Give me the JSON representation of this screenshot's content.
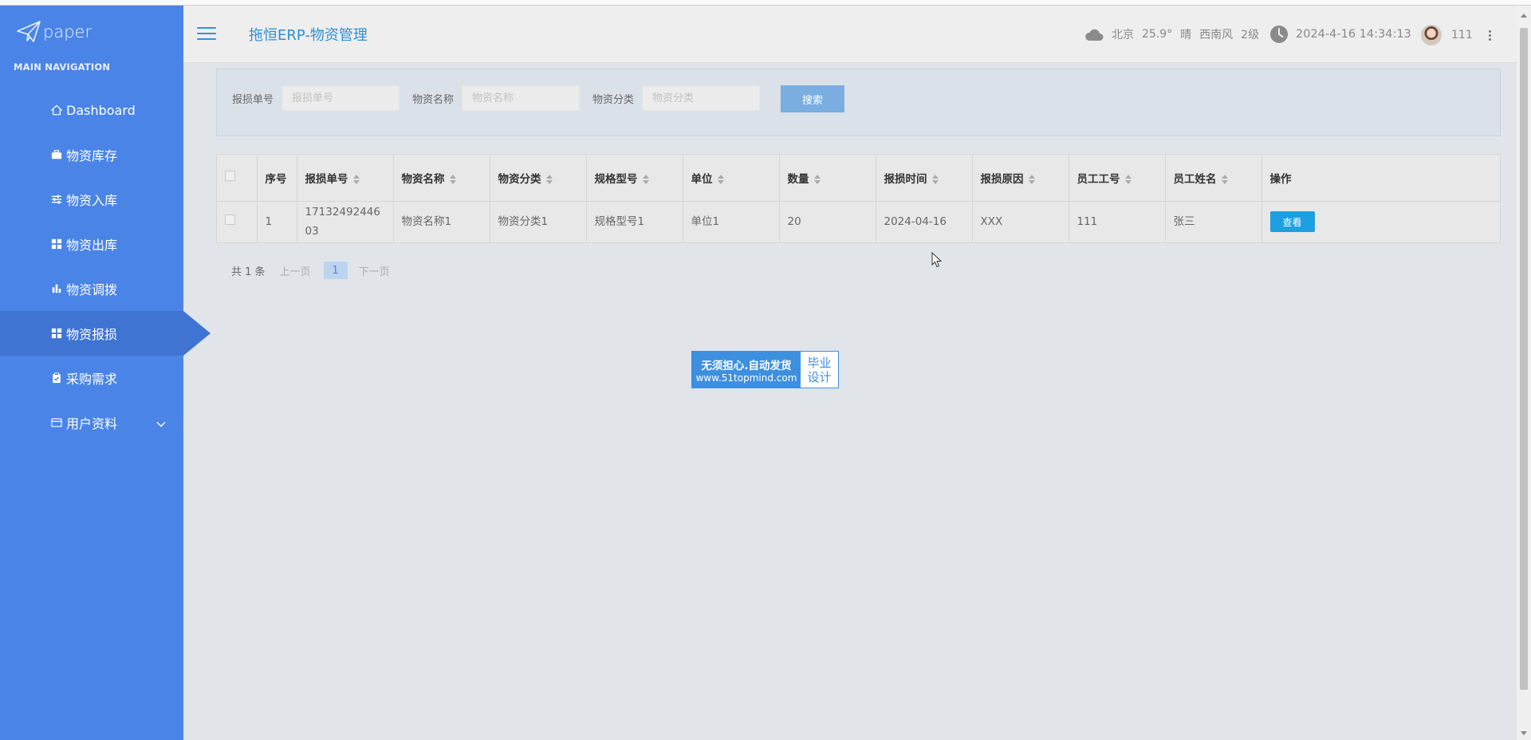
{
  "sidebar": {
    "logo_text": "paper",
    "heading": "MAIN NAVIGATION",
    "items": [
      {
        "label": "Dashboard",
        "icon": "home-icon"
      },
      {
        "label": "物资库存",
        "icon": "briefcase-icon"
      },
      {
        "label": "物资入库",
        "icon": "sliders-icon"
      },
      {
        "label": "物资出库",
        "icon": "grid-icon"
      },
      {
        "label": "物资调拨",
        "icon": "bar-chart-icon"
      },
      {
        "label": "物资报损",
        "icon": "grid-icon"
      },
      {
        "label": "采购需求",
        "icon": "clipboard-icon"
      },
      {
        "label": "用户资料",
        "icon": "card-icon"
      }
    ],
    "active_index": 5
  },
  "header": {
    "title": "拖恒ERP-物资管理",
    "weather": {
      "city": "北京",
      "temp": "25.9°",
      "condition": "晴",
      "wind": "西南风",
      "level": "2级"
    },
    "datetime": "2024-4-16 14:34:13",
    "username": "111"
  },
  "search": {
    "fields": [
      {
        "label": "报损单号",
        "placeholder": "报损单号"
      },
      {
        "label": "物资名称",
        "placeholder": "物资名称"
      },
      {
        "label": "物资分类",
        "placeholder": "物资分类"
      }
    ],
    "button": "搜索"
  },
  "table": {
    "columns": [
      "序号",
      "报损单号",
      "物资名称",
      "物资分类",
      "规格型号",
      "单位",
      "数量",
      "报损时间",
      "报损原因",
      "员工工号",
      "员工姓名",
      "操作"
    ],
    "rows": [
      {
        "cells": [
          "1",
          "1713249244603",
          "物资名称1",
          "物资分类1",
          "规格型号1",
          "单位1",
          "20",
          "2024-04-16",
          "XXX",
          "111",
          "张三"
        ],
        "action": "查看"
      }
    ]
  },
  "pagination": {
    "total": "共 1 条",
    "prev": "上一页",
    "current": "1",
    "next": "下一页"
  },
  "badge": {
    "line1": "无须担心.自动发货",
    "line2": "www.51topmind.com",
    "right1": "毕业",
    "right2": "设计"
  },
  "colors": {
    "sidebar": "#4a84e6",
    "sidebar_active": "#3f74d2",
    "title": "#2f8fd5",
    "view_button": "#1e9fe0"
  }
}
